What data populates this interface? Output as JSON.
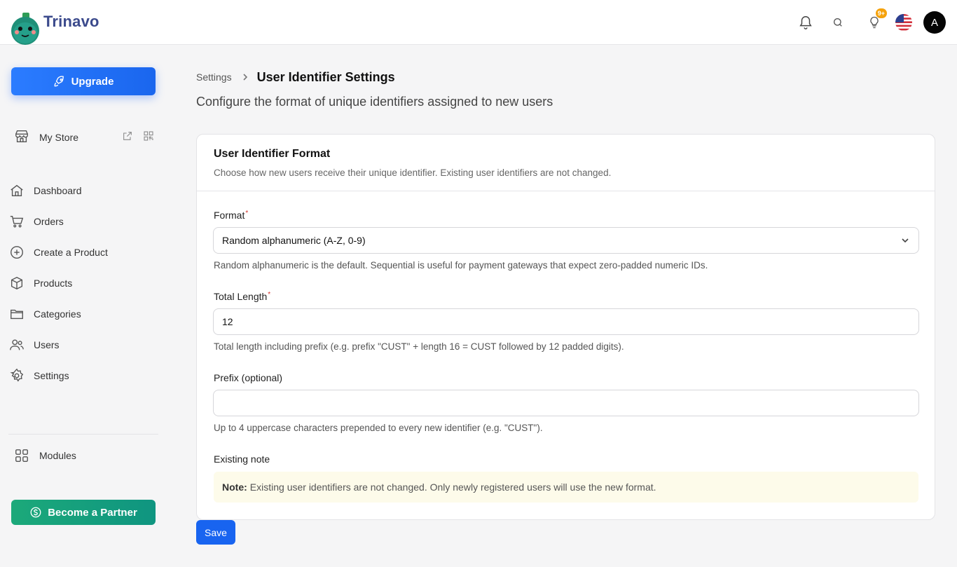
{
  "header": {
    "app_name": "Trinavo",
    "notifications_badge": "9+",
    "avatar_initial": "A"
  },
  "sidebar": {
    "upgrade_label": "Upgrade",
    "store_label": "My Store",
    "items": [
      {
        "label": "Dashboard",
        "icon": "home-icon"
      },
      {
        "label": "Orders",
        "icon": "cart-icon"
      },
      {
        "label": "Create a Product",
        "icon": "plus-circle-icon"
      },
      {
        "label": "Products",
        "icon": "box-icon"
      },
      {
        "label": "Categories",
        "icon": "folder-icon"
      },
      {
        "label": "Users",
        "icon": "users-icon"
      },
      {
        "label": "Settings",
        "icon": "gear-icon"
      }
    ],
    "modules_label": "Modules",
    "partner_label": "Become a Partner"
  },
  "breadcrumb": {
    "parent": "Settings",
    "current": "User Identifier Settings"
  },
  "page": {
    "subtitle": "Configure the format of unique identifiers assigned to new users"
  },
  "card": {
    "title": "User Identifier Format",
    "description": "Choose how new users receive their unique identifier. Existing user identifiers are not changed.",
    "format": {
      "label": "Format",
      "required_mark": "*",
      "value": "Random alphanumeric (A-Z, 0-9)",
      "help": "Random alphanumeric is the default. Sequential is useful for payment gateways that expect zero-padded numeric IDs."
    },
    "length": {
      "label": "Total Length",
      "required_mark": "*",
      "value": "12",
      "help": "Total length including prefix (e.g. prefix \"CUST\" + length 16 = CUST followed by 12 padded digits)."
    },
    "prefix": {
      "label": "Prefix (optional)",
      "value": "",
      "help": "Up to 4 uppercase characters prepended to every new identifier (e.g. \"CUST\")."
    },
    "note": {
      "label": "Existing note",
      "bold": "Note:",
      "text": "Existing user identifiers are not changed. Only newly registered users will use the new format."
    }
  },
  "actions": {
    "save_label": "Save"
  },
  "colors": {
    "primary": "#1864f0",
    "partner": "#13a07c",
    "brand_text": "#3b4a8c",
    "badge": "#f5a20c",
    "required": "#d4322b"
  }
}
